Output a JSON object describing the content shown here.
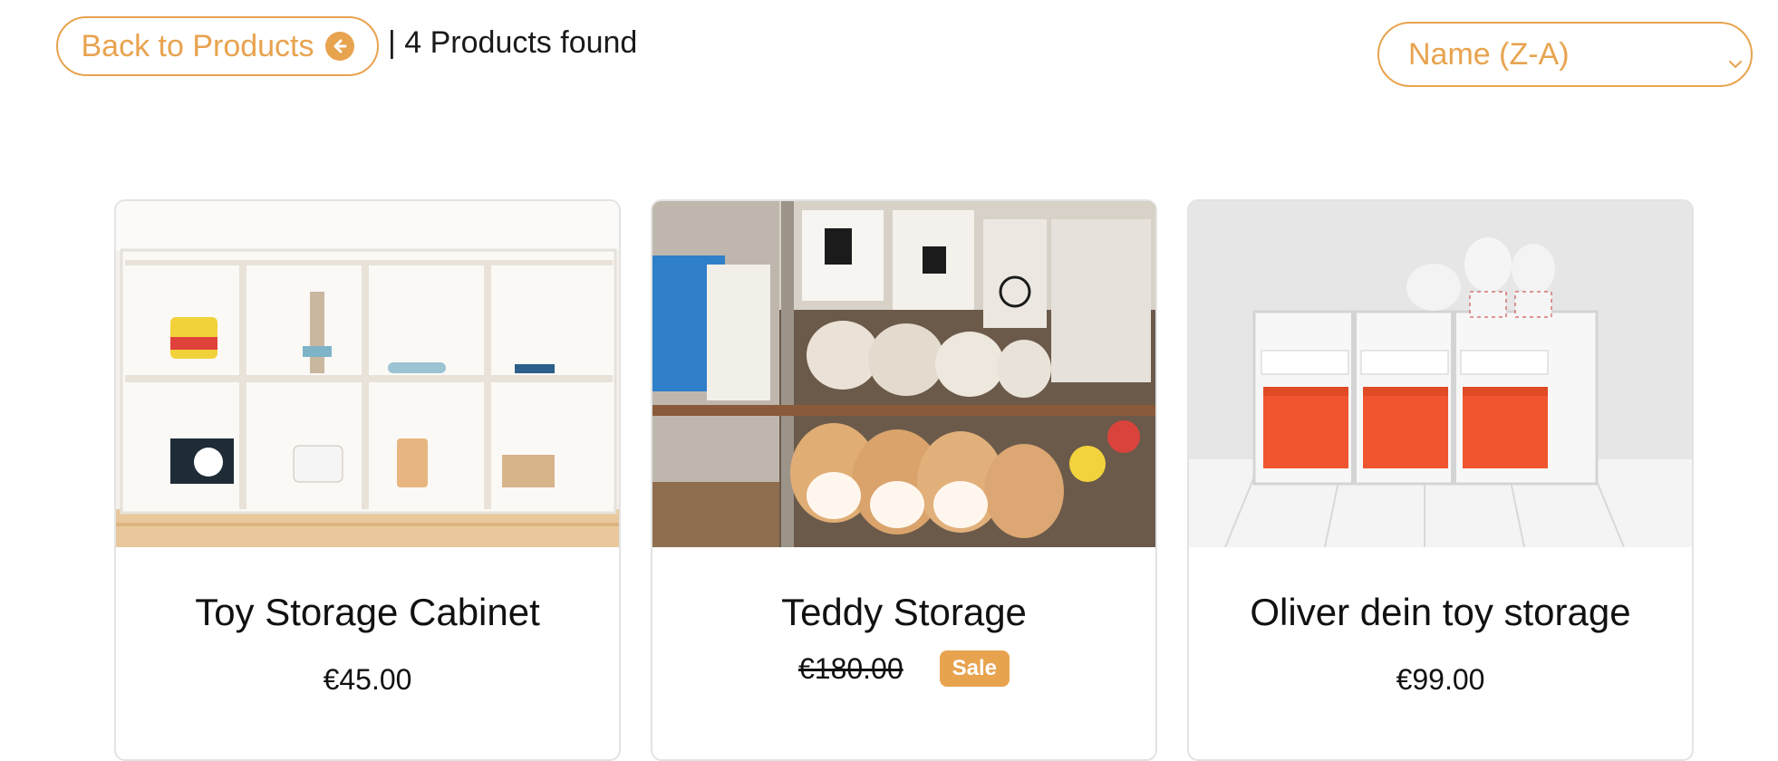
{
  "toolbar": {
    "back_label": "Back to Products",
    "count_text": "| 4 Products found",
    "sort_value": "Name (Z-A)"
  },
  "colors": {
    "accent": "#e8a34f",
    "text": "#1a1a1a",
    "card_border": "#e3e3e3"
  },
  "products": [
    {
      "title": "Toy Storage Cabinet",
      "price": "€45.00",
      "image_icon": "shelf-cabinet-image"
    },
    {
      "title": "Teddy Storage",
      "old_price": "€180.00",
      "badge": "Sale",
      "image_icon": "teddy-shelf-image"
    },
    {
      "title": "Oliver dein toy storage",
      "price": "€99.00",
      "image_icon": "bins-storage-image"
    }
  ]
}
